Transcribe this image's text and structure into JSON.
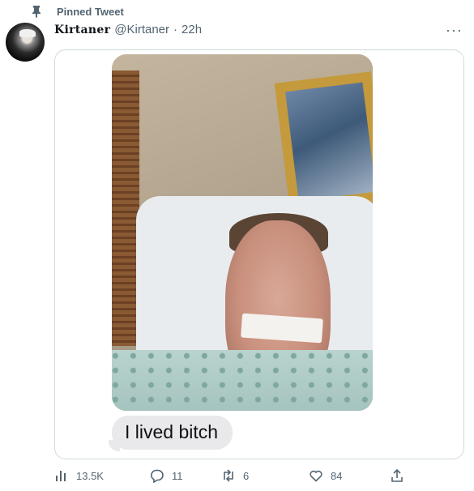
{
  "pinned": {
    "label": "Pinned Tweet",
    "icon": "pin-icon"
  },
  "author": {
    "display_name": "Kirtaner",
    "handle": "@Kirtaner",
    "separator": "·",
    "time": "22h"
  },
  "more_icon": "more-options-icon",
  "media": {
    "caption": "I lived bitch"
  },
  "actions": {
    "views": {
      "count": "13.5K",
      "icon": "analytics-icon"
    },
    "reply": {
      "count": "11",
      "icon": "reply-icon"
    },
    "retweet": {
      "count": "6",
      "icon": "retweet-icon"
    },
    "like": {
      "count": "84",
      "icon": "heart-icon"
    },
    "share": {
      "icon": "share-icon"
    }
  },
  "colors": {
    "muted": "#536471",
    "border": "#cfd9de",
    "bubble": "#e9e9eb"
  }
}
